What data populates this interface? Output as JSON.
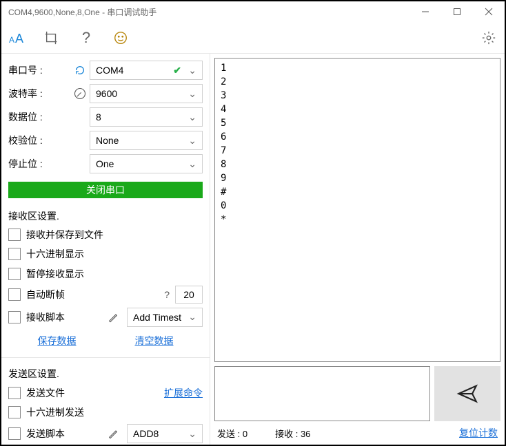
{
  "title": "COM4,9600,None,8,One - 串口调试助手",
  "config": {
    "port": {
      "label": "串口号 :",
      "value": "COM4"
    },
    "baud": {
      "label": "波特率 :",
      "value": "9600"
    },
    "databits": {
      "label": "数据位 :",
      "value": "8"
    },
    "parity": {
      "label": "校验位 :",
      "value": "None"
    },
    "stopbits": {
      "label": "停止位 :",
      "value": "One"
    }
  },
  "close_port_label": "关闭串口",
  "recv_section": {
    "title": "接收区设置.",
    "save_to_file": "接收并保存到文件",
    "hex_display": "十六进制显示",
    "pause_display": "暂停接收显示",
    "auto_frame": {
      "label": "自动断帧",
      "question": "?",
      "value": "20"
    },
    "recv_script": {
      "label": "接收脚本",
      "value": "Add Timest"
    },
    "save_data": "保存数据",
    "clear_data": "清空数据"
  },
  "send_section": {
    "title": "发送区设置.",
    "send_file": "发送文件",
    "ext_cmd": "扩展命令",
    "hex_send": "十六进制发送",
    "send_script": {
      "label": "发送脚本",
      "value": "ADD8"
    }
  },
  "received_text": "1\n2\n3\n4\n5\n6\n7\n8\n9\n#\n0\n*",
  "status": {
    "send": {
      "label": "发送 :",
      "value": "0"
    },
    "recv": {
      "label": "接收 :",
      "value": "36"
    },
    "reset": "复位计数"
  }
}
